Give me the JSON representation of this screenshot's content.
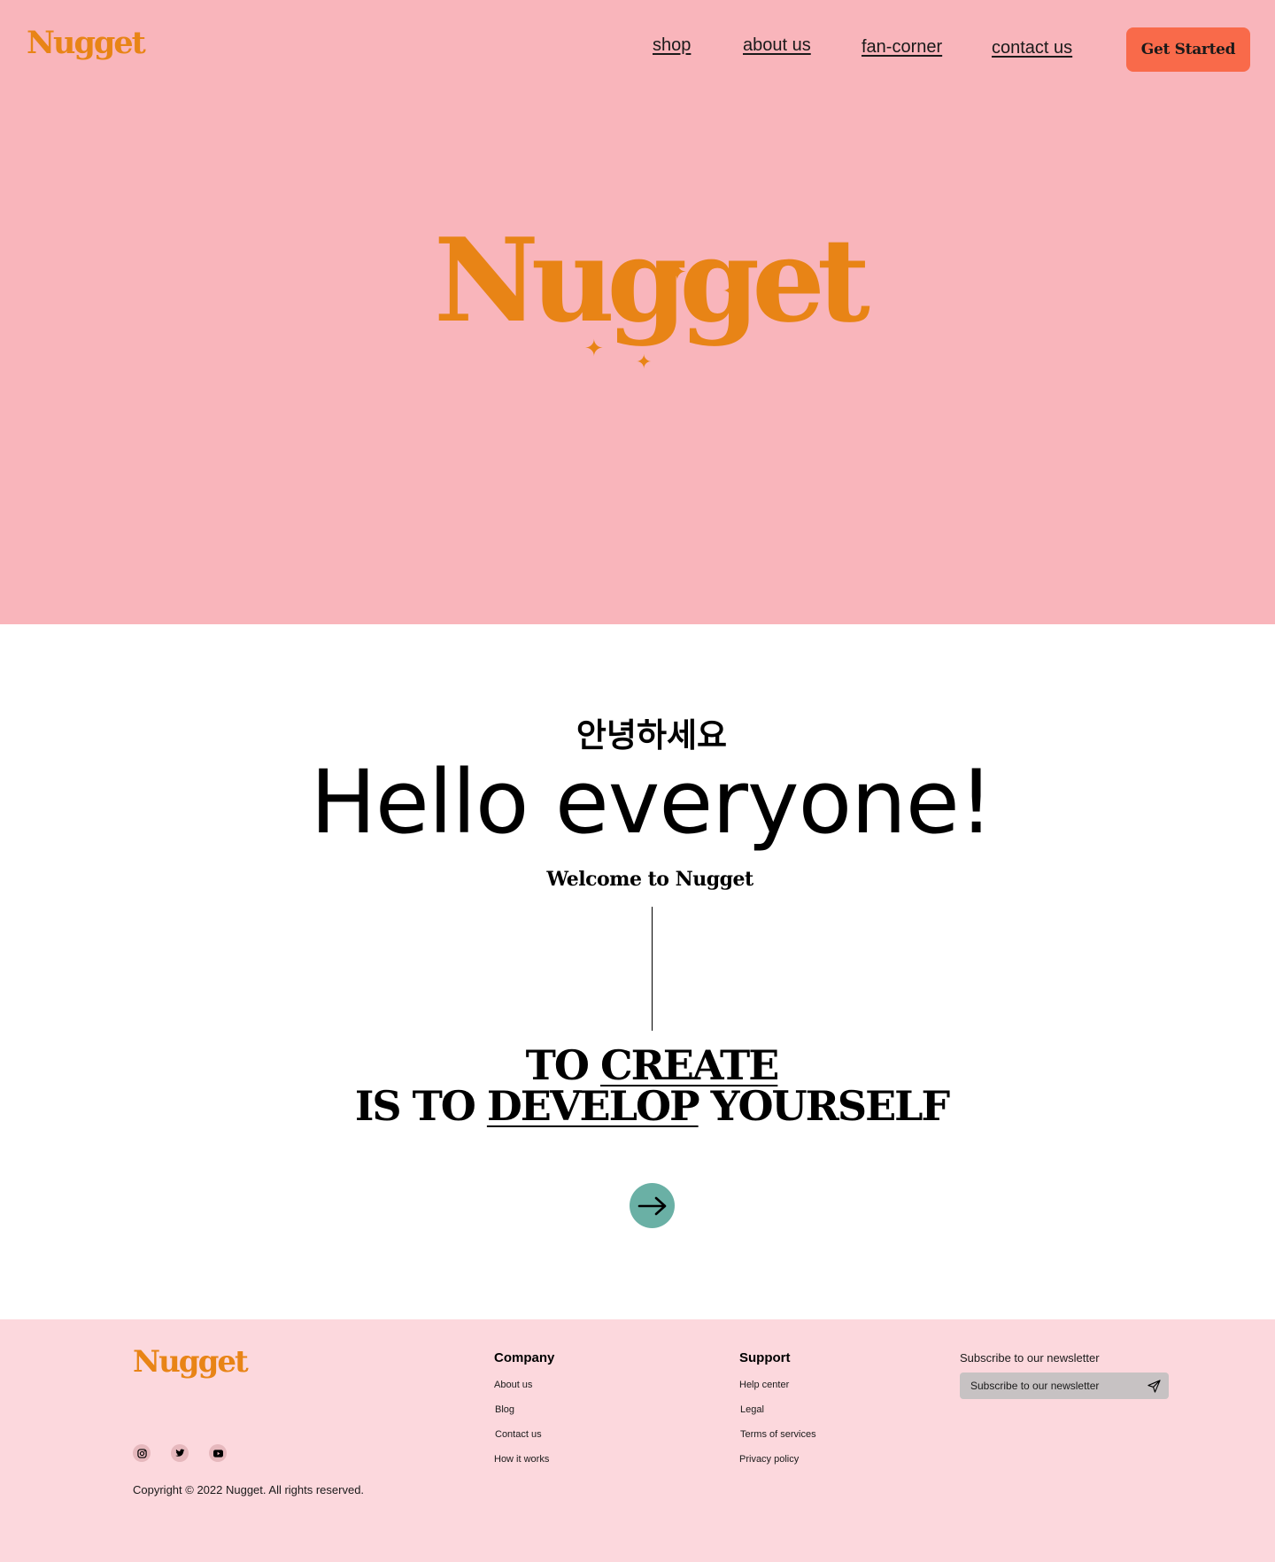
{
  "header": {
    "logo": "Nugget",
    "nav": [
      {
        "label": "shop"
      },
      {
        "label": "about us"
      },
      {
        "label": "fan-corner"
      },
      {
        "label": "contact us"
      }
    ],
    "cta_label": "Get Started"
  },
  "hero": {
    "logo": "Nugget"
  },
  "welcome": {
    "korean_greeting": "안녕하세요",
    "headline": "Hello everyone!",
    "subtitle": "Welcome to Nugget"
  },
  "quote": {
    "line1_prefix": "TO ",
    "line1_emphasis": "CREATE",
    "line2_prefix": "IS TO ",
    "line2_emphasis": "DEVELOP",
    "line2_suffix": " YOURSELF"
  },
  "arrow_button": {
    "icon": "arrow-right-icon"
  },
  "footer": {
    "logo": "Nugget",
    "social_icons": [
      "instagram-icon",
      "twitter-icon",
      "youtube-icon"
    ],
    "copyright": "Copyright © 2022 Nugget. All rights reserved.",
    "company": {
      "title": "Company",
      "links": [
        "About us",
        "Blog",
        "Contact us",
        "How it works"
      ]
    },
    "support": {
      "title": "Support",
      "links": [
        "Help center",
        "Legal",
        "Terms of services",
        "Privacy policy"
      ]
    },
    "newsletter": {
      "label": "Subscribe to our newsletter",
      "placeholder": "Subscribe to our newsletter"
    }
  },
  "colors": {
    "hero_bg": "#f9b5bb",
    "footer_bg": "#fcd8dd",
    "brand_orange": "#e88416",
    "cta_bg": "#f96a4a",
    "arrow_bg": "#6ab0a5"
  }
}
